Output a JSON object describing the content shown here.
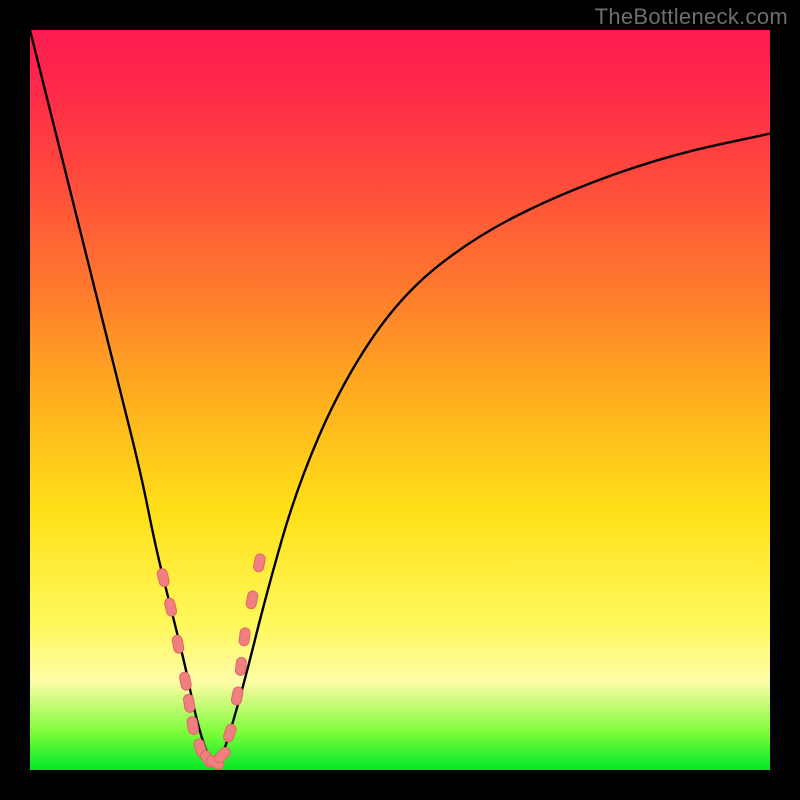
{
  "watermark": "TheBottleneck.com",
  "colors": {
    "frame": "#000000",
    "curve": "#000000",
    "marker_fill": "#f08080",
    "marker_stroke": "#e06666",
    "gradient_stops": [
      "#ff1a50",
      "#ff2a4a",
      "#ff4a3c",
      "#ff7a2e",
      "#ffb01e",
      "#ffe018",
      "#fff85a",
      "#fffca8",
      "#7cfc3a",
      "#00e828"
    ]
  },
  "chart_data": {
    "type": "line",
    "title": "",
    "xlabel": "",
    "ylabel": "",
    "xlim": [
      0,
      100
    ],
    "ylim": [
      0,
      100
    ],
    "axes_visible": false,
    "series": [
      {
        "name": "bottleneck-curve",
        "x": [
          0,
          3,
          6,
          9,
          12,
          15,
          17,
          19,
          21,
          22,
          23,
          24,
          25,
          26,
          27,
          29,
          32,
          36,
          42,
          50,
          60,
          72,
          86,
          100
        ],
        "values": [
          100,
          88,
          76,
          64,
          52,
          40,
          30,
          22,
          14,
          9,
          5,
          2,
          1,
          2,
          5,
          12,
          24,
          38,
          52,
          64,
          72,
          78,
          83,
          86
        ]
      }
    ],
    "markers": {
      "name": "highlight-points",
      "comment": "salmon rounded markers clustered around the V minimum",
      "x": [
        18,
        19,
        20,
        21,
        21.5,
        22,
        23,
        24,
        25,
        26,
        27,
        28,
        28.5,
        29,
        30,
        31
      ],
      "values": [
        26,
        22,
        17,
        12,
        9,
        6,
        3,
        1.5,
        1,
        2,
        5,
        10,
        14,
        18,
        23,
        28
      ]
    }
  }
}
